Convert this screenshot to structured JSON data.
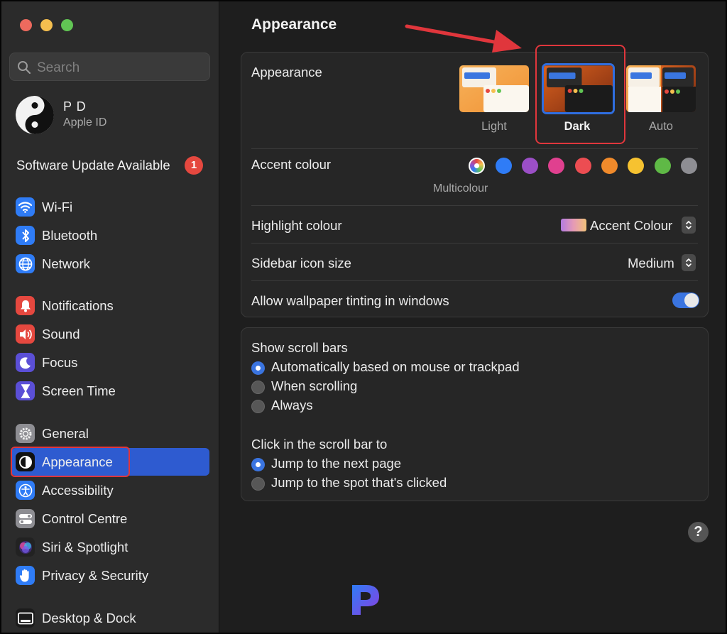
{
  "window": {
    "traffic_lights": [
      "#ed6a5e",
      "#f5bf4f",
      "#61c554"
    ]
  },
  "sidebar": {
    "search_placeholder": "Search",
    "profile": {
      "name": "P D",
      "subtitle": "Apple ID"
    },
    "update": {
      "label": "Software Update Available",
      "badge": "1"
    },
    "items": [
      {
        "label": "Wi-Fi",
        "icon": "wifi-icon",
        "color": "#2f7cf6"
      },
      {
        "label": "Bluetooth",
        "icon": "bluetooth-icon",
        "color": "#2f7cf6"
      },
      {
        "label": "Network",
        "icon": "globe-icon",
        "color": "#2f7cf6"
      },
      {
        "label": "Notifications",
        "icon": "bell-icon",
        "color": "#e5483f"
      },
      {
        "label": "Sound",
        "icon": "speaker-icon",
        "color": "#e5483f"
      },
      {
        "label": "Focus",
        "icon": "moon-icon",
        "color": "#5b4fd6"
      },
      {
        "label": "Screen Time",
        "icon": "hourglass-icon",
        "color": "#5b4fd6"
      },
      {
        "label": "General",
        "icon": "gear-icon",
        "color": "#8e8e93"
      },
      {
        "label": "Appearance",
        "icon": "appearance-icon",
        "color": "#111111"
      },
      {
        "label": "Accessibility",
        "icon": "accessibility-icon",
        "color": "#2f7cf6"
      },
      {
        "label": "Control Centre",
        "icon": "toggles-icon",
        "color": "#8e8e93"
      },
      {
        "label": "Siri & Spotlight",
        "icon": "siri-icon",
        "color": "#222222"
      },
      {
        "label": "Privacy & Security",
        "icon": "hand-icon",
        "color": "#2f7cf6"
      },
      {
        "label": "Desktop & Dock",
        "icon": "dock-icon",
        "color": "#1c1c1c"
      }
    ],
    "selected_item": "Appearance"
  },
  "main": {
    "title": "Appearance",
    "appearance": {
      "label": "Appearance",
      "options": [
        "Light",
        "Dark",
        "Auto"
      ],
      "selected": "Dark"
    },
    "accent": {
      "label": "Accent colour",
      "selected_name": "Multicolour",
      "colors": [
        "#2f7cf6",
        "#9b4fc6",
        "#e0408f",
        "#ec4d52",
        "#f08a2b",
        "#f6c230",
        "#5fb946",
        "#8e8e93"
      ]
    },
    "highlight": {
      "label": "Highlight colour",
      "value": "Accent Colour"
    },
    "sidebar_icon_size": {
      "label": "Sidebar icon size",
      "value": "Medium"
    },
    "wallpaper_tinting": {
      "label": "Allow wallpaper tinting in windows",
      "enabled": true
    },
    "scroll_bars": {
      "label": "Show scroll bars",
      "options": [
        "Automatically based on mouse or trackpad",
        "When scrolling",
        "Always"
      ],
      "selected": "Automatically based on mouse or trackpad"
    },
    "click_scroll": {
      "label": "Click in the scroll bar to",
      "options": [
        "Jump to the next page",
        "Jump to the spot that's clicked"
      ],
      "selected": "Jump to the next page"
    },
    "help": "?"
  },
  "annotation": {
    "color": "#e0363c"
  }
}
